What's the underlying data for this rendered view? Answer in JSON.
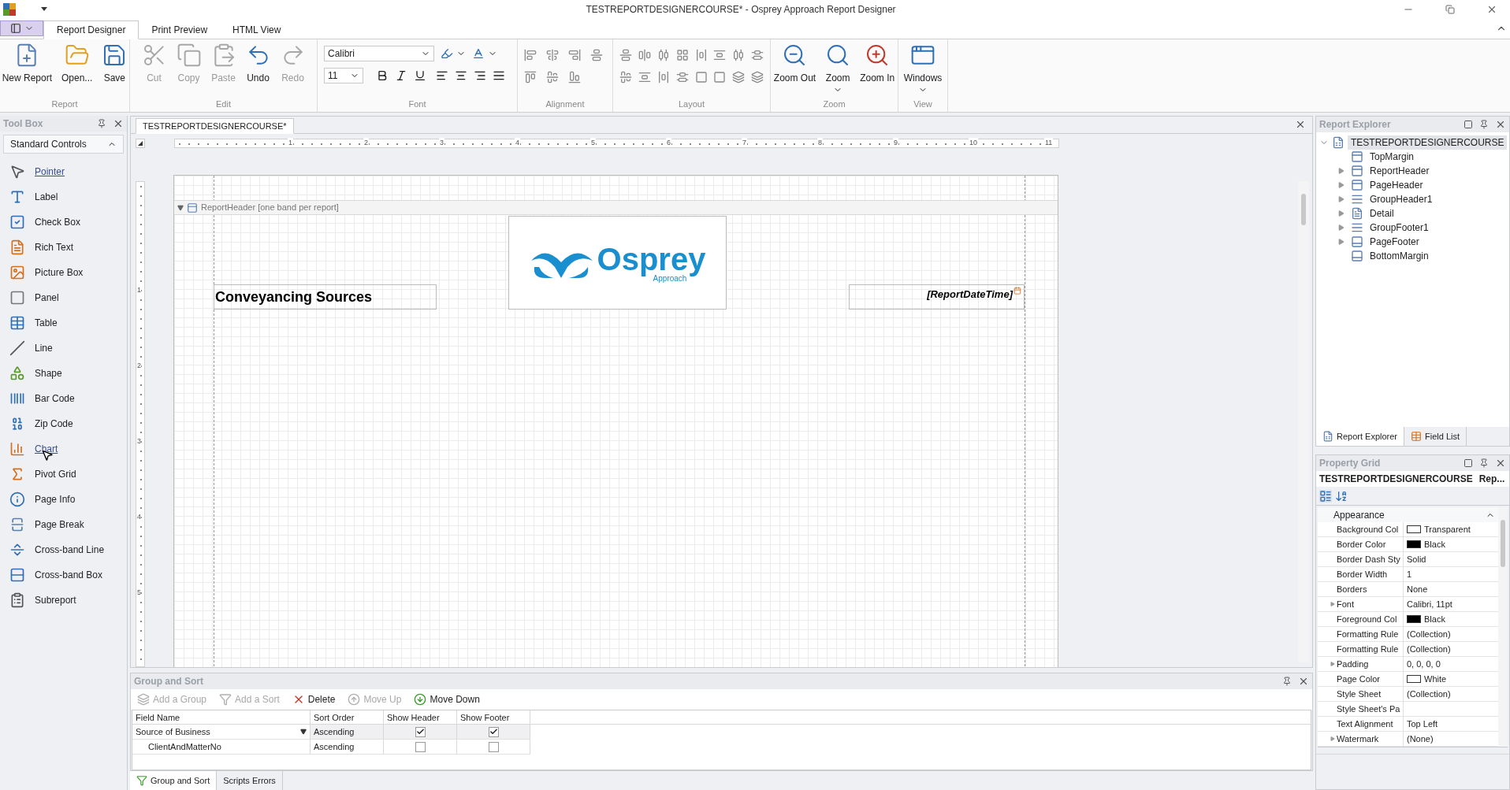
{
  "window": {
    "title": "TESTREPORTDESIGNERCOURSE* - Osprey Approach Report Designer"
  },
  "ribbon": {
    "tabs": [
      {
        "label": "Report Designer",
        "selected": true
      },
      {
        "label": "Print Preview",
        "selected": false
      },
      {
        "label": "HTML View",
        "selected": false
      }
    ],
    "groups": [
      {
        "label": "Report",
        "kind": "buttons",
        "buttons": [
          {
            "label": "New Report",
            "disabled": false,
            "menu": false
          },
          {
            "label": "Open...",
            "disabled": false,
            "menu": false
          },
          {
            "label": "Save",
            "disabled": false,
            "menu": false
          }
        ]
      },
      {
        "label": "Edit",
        "kind": "buttons",
        "buttons": [
          {
            "label": "Cut",
            "disabled": true,
            "menu": false
          },
          {
            "label": "Copy",
            "disabled": true,
            "menu": false
          },
          {
            "label": "Paste",
            "disabled": true,
            "menu": false
          },
          {
            "label": "Undo",
            "disabled": false,
            "menu": false
          },
          {
            "label": "Redo",
            "disabled": true,
            "menu": false
          }
        ]
      },
      {
        "label": "Font",
        "kind": "font",
        "font_name": "Calibri",
        "font_size": "11"
      },
      {
        "label": "Alignment",
        "kind": "alignment"
      },
      {
        "label": "Layout",
        "kind": "layout"
      },
      {
        "label": "Zoom",
        "kind": "buttons",
        "buttons": [
          {
            "label": "Zoom Out",
            "disabled": false,
            "menu": false
          },
          {
            "label": "Zoom",
            "disabled": false,
            "menu": true
          },
          {
            "label": "Zoom In",
            "disabled": false,
            "menu": false
          }
        ]
      },
      {
        "label": "View",
        "kind": "buttons",
        "buttons": [
          {
            "label": "Windows",
            "disabled": false,
            "menu": true
          }
        ]
      }
    ]
  },
  "toolbox": {
    "title": "Tool Box",
    "section": {
      "label": "Standard Controls",
      "expanded": true
    },
    "items": [
      {
        "label": "Pointer",
        "selected": true,
        "hovered": false
      },
      {
        "label": "Label",
        "selected": false,
        "hovered": false
      },
      {
        "label": "Check Box",
        "selected": false,
        "hovered": false
      },
      {
        "label": "Rich Text",
        "selected": false,
        "hovered": false
      },
      {
        "label": "Picture Box",
        "selected": false,
        "hovered": false
      },
      {
        "label": "Panel",
        "selected": false,
        "hovered": false
      },
      {
        "label": "Table",
        "selected": false,
        "hovered": false
      },
      {
        "label": "Line",
        "selected": false,
        "hovered": false
      },
      {
        "label": "Shape",
        "selected": false,
        "hovered": false
      },
      {
        "label": "Bar Code",
        "selected": false,
        "hovered": false
      },
      {
        "label": "Zip Code",
        "selected": false,
        "hovered": false
      },
      {
        "label": "Chart",
        "selected": false,
        "hovered": true
      },
      {
        "label": "Pivot Grid",
        "selected": false,
        "hovered": false
      },
      {
        "label": "Page Info",
        "selected": false,
        "hovered": false
      },
      {
        "label": "Page Break",
        "selected": false,
        "hovered": false
      },
      {
        "label": "Cross-band Line",
        "selected": false,
        "hovered": false
      },
      {
        "label": "Cross-band Box",
        "selected": false,
        "hovered": false
      },
      {
        "label": "Subreport",
        "selected": false,
        "hovered": false
      }
    ]
  },
  "document": {
    "tab": {
      "label": "TESTREPORTDESIGNERCOURSE*",
      "selected": true
    },
    "ruler": [
      "1",
      "2",
      "3",
      "4",
      "5",
      "6",
      "7",
      "8",
      "9",
      "10",
      "11"
    ],
    "vertical_ruler": [
      "1",
      "2",
      "3",
      "4",
      "5"
    ],
    "band": {
      "label": "ReportHeader [one band per report]",
      "expanded": true
    },
    "title_label": "Conveyancing Sources",
    "logo": {
      "name": "Osprey",
      "tagline": "Approach"
    },
    "date_field": "[ReportDateTime]"
  },
  "report_explorer": {
    "title": "Report Explorer",
    "tree": [
      {
        "label": "TESTREPORTDESIGNERCOURSE",
        "expanded": true,
        "selected": true,
        "children": [
          {
            "label": "TopMargin",
            "expandable": false,
            "selected": false
          },
          {
            "label": "ReportHeader",
            "expandable": true,
            "selected": false
          },
          {
            "label": "PageHeader",
            "expandable": true,
            "selected": false
          },
          {
            "label": "GroupHeader1",
            "expandable": true,
            "selected": false
          },
          {
            "label": "Detail",
            "expandable": true,
            "selected": false
          },
          {
            "label": "GroupFooter1",
            "expandable": true,
            "selected": false
          },
          {
            "label": "PageFooter",
            "expandable": true,
            "selected": false
          },
          {
            "label": "BottomMargin",
            "expandable": false,
            "selected": false
          }
        ]
      }
    ],
    "tabs": [
      {
        "label": "Report Explorer",
        "selected": true
      },
      {
        "label": "Field List",
        "selected": false
      }
    ]
  },
  "property_grid": {
    "title": "Property Grid",
    "object": {
      "name": "TESTREPORTDESIGNERCOURSE",
      "type": "Rep..."
    },
    "category": {
      "label": "Appearance",
      "expanded": true
    },
    "rows": [
      {
        "name": "Background Col",
        "value": "Transparent",
        "expandable": false,
        "color": "#ffffff"
      },
      {
        "name": "Border Color",
        "value": "Black",
        "expandable": false,
        "color": "#000000"
      },
      {
        "name": "Border Dash Sty",
        "value": "Solid",
        "expandable": false
      },
      {
        "name": "Border Width",
        "value": "1",
        "expandable": false
      },
      {
        "name": "Borders",
        "value": "None",
        "expandable": false
      },
      {
        "name": "Font",
        "value": "Calibri, 11pt",
        "expandable": true
      },
      {
        "name": "Foreground Col",
        "value": "Black",
        "expandable": false,
        "color": "#000000"
      },
      {
        "name": "Formatting Rule",
        "value": "(Collection)",
        "expandable": false
      },
      {
        "name": "Formatting Rule",
        "value": "(Collection)",
        "expandable": false
      },
      {
        "name": "Padding",
        "value": "0, 0, 0, 0",
        "expandable": true
      },
      {
        "name": "Page Color",
        "value": "White",
        "expandable": false,
        "color": "#ffffff"
      },
      {
        "name": "Style Sheet",
        "value": "(Collection)",
        "expandable": false
      },
      {
        "name": "Style Sheet's Pa",
        "expandable": false
      },
      {
        "name": "Text Alignment",
        "value": "Top Left",
        "expandable": false
      },
      {
        "name": "Watermark",
        "value": "(None)",
        "expandable": true
      }
    ]
  },
  "group_sort": {
    "title": "Group and Sort",
    "toolbar": [
      {
        "label": "Add a Group",
        "disabled": true
      },
      {
        "label": "Add a Sort",
        "disabled": true
      },
      {
        "label": "Delete",
        "disabled": false
      },
      {
        "label": "Move Up",
        "disabled": true
      },
      {
        "label": "Move Down",
        "disabled": false
      }
    ],
    "columns": [
      "Field Name",
      "Sort Order",
      "Show Header",
      "Show Footer"
    ],
    "rows": [
      {
        "field": "Source of Business",
        "sort_order": "Ascending",
        "show_header": true,
        "show_footer": true,
        "selected": true,
        "children": [
          {
            "field": "ClientAndMatterNo",
            "sort_order": "Ascending",
            "show_header": false,
            "show_footer": false,
            "selected": false
          }
        ]
      }
    ],
    "tabs": [
      {
        "label": "Group and Sort",
        "selected": true
      },
      {
        "label": "Scripts Errors",
        "selected": false
      }
    ]
  }
}
